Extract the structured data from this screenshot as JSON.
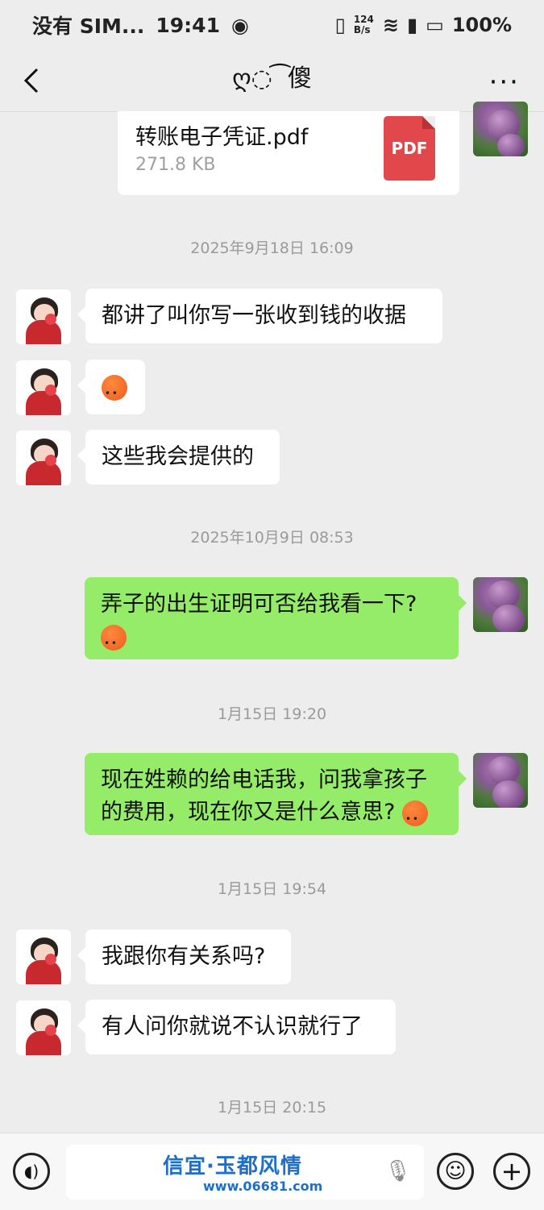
{
  "status_bar": {
    "carrier": "没有 SIM...",
    "time": "19:41",
    "network_speed": "124 B/s",
    "battery": "100%"
  },
  "nav": {
    "title": "ღ◌ ͡ 傻",
    "more": "···"
  },
  "file_message": {
    "file_name": "转账电子凭证.pdf",
    "file_size": "271.8 KB",
    "file_type": "PDF"
  },
  "messages": [
    {
      "type": "timestamp",
      "text": "2025年9月18日 16:09"
    },
    {
      "type": "in",
      "text": "都讲了叫你写一张收到钱的收据"
    },
    {
      "type": "in",
      "text": "",
      "emoji": "sweat-angry"
    },
    {
      "type": "in",
      "text": "这些我会提供的"
    },
    {
      "type": "timestamp",
      "text": "2025年10月9日 08:53"
    },
    {
      "type": "out",
      "text": "弄子的出生证明可否给我看一下?",
      "emoji": "sweat-angry"
    },
    {
      "type": "timestamp",
      "text": "1月15日 19:20"
    },
    {
      "type": "out",
      "text": "现在姓赖的给电话我，问我拿孩子的费用，现在你又是什么意思?",
      "emoji": "sweat-angry"
    },
    {
      "type": "timestamp",
      "text": "1月15日 19:54"
    },
    {
      "type": "in",
      "text": "我跟你有关系吗?"
    },
    {
      "type": "in",
      "text": "有人问你就说不认识就行了"
    },
    {
      "type": "timestamp",
      "text": "1月15日 20:15"
    }
  ],
  "bottom_bar": {
    "watermark_title": "信宜·玉都风情",
    "watermark_url": "www.06681.com"
  },
  "colors": {
    "background": "#EDEDED",
    "incoming_bubble": "#FFFFFF",
    "outgoing_bubble": "#95EC69"
  }
}
